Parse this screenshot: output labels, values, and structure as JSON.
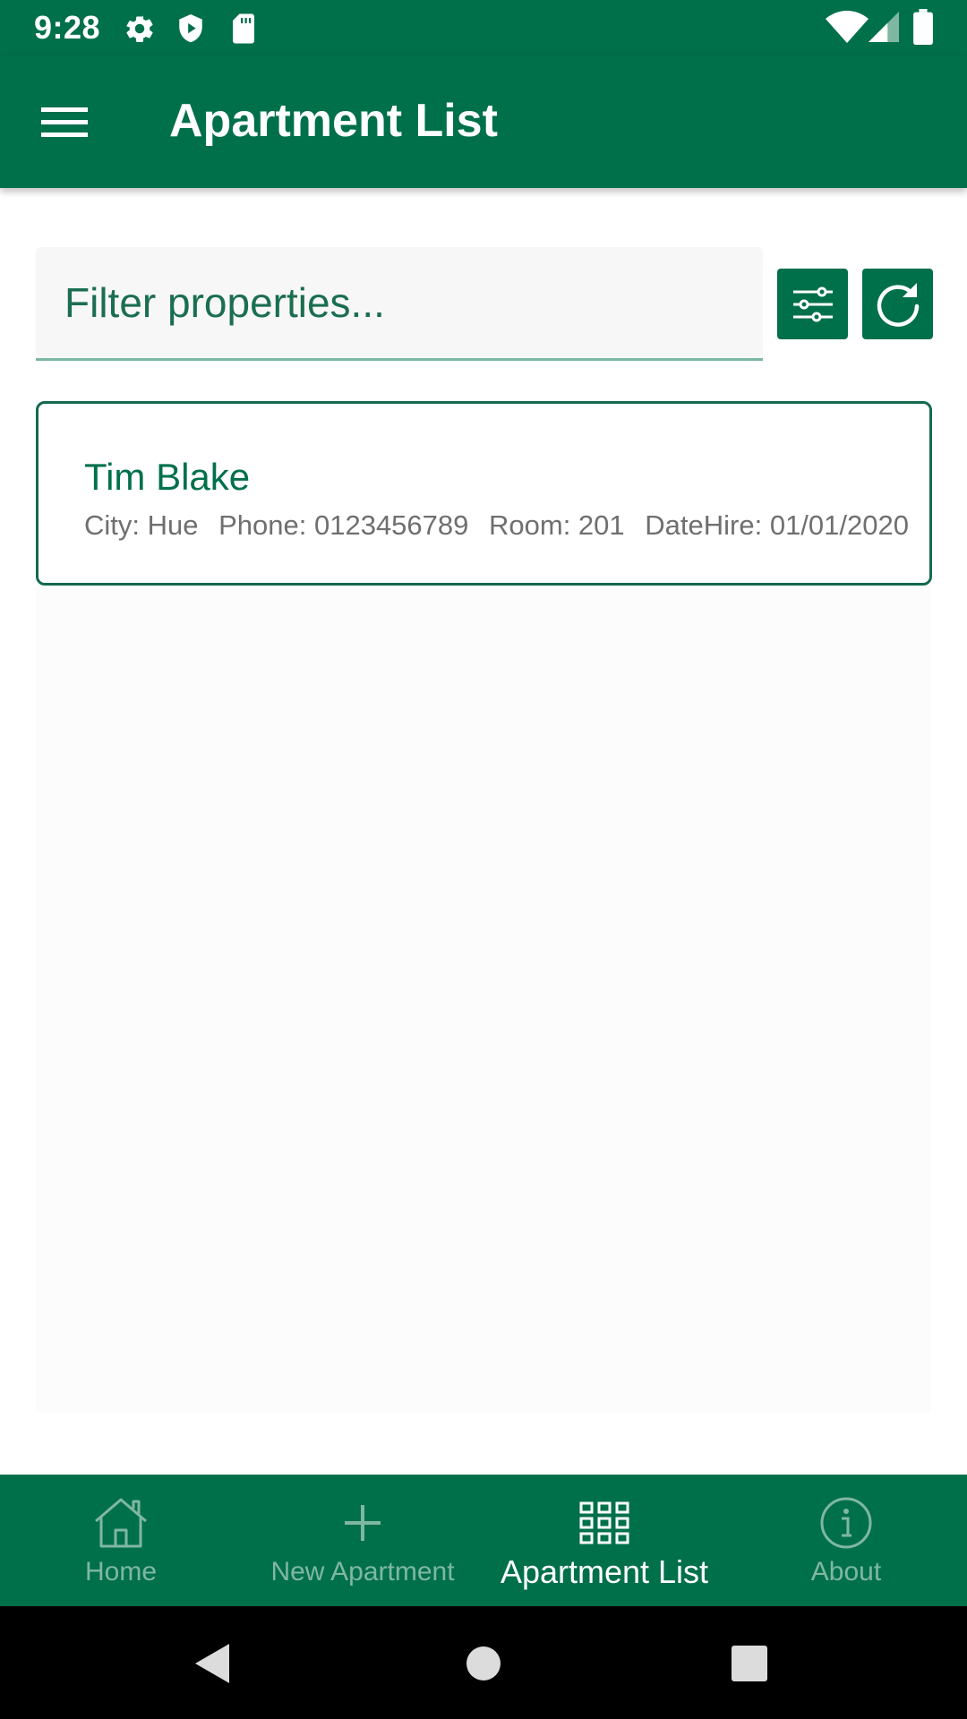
{
  "status_bar": {
    "time": "9:28",
    "left_icons": [
      "gear-icon",
      "shield-play-icon",
      "sd-card-icon"
    ],
    "right_icons": [
      "wifi-icon",
      "signal-icon",
      "battery-icon"
    ]
  },
  "app_bar": {
    "menu_icon": "hamburger-menu-icon",
    "title": "Apartment List"
  },
  "filter": {
    "placeholder": "Filter properties...",
    "value": "",
    "filter_button_icon": "sliders-icon",
    "refresh_button_icon": "refresh-icon"
  },
  "apartments": [
    {
      "name": "Tim Blake",
      "city": "City: Hue",
      "phone": "Phone: 0123456789",
      "room": "Room: 201",
      "date_hire": "DateHire: 01/01/2020"
    }
  ],
  "bottom_nav": {
    "items": [
      {
        "label": "Home",
        "icon": "home-icon",
        "active": false
      },
      {
        "label": "New Apartment",
        "icon": "plus-icon",
        "active": false
      },
      {
        "label": "Apartment List",
        "icon": "grid-icon",
        "active": true
      },
      {
        "label": "About",
        "icon": "info-icon",
        "active": false
      }
    ]
  },
  "system_nav": [
    "back-icon",
    "home-circle-icon",
    "recents-icon"
  ],
  "colors": {
    "primary": "#00704a",
    "nav_inactive": "#7fb7a3",
    "detail_text": "#6f6f6f"
  }
}
